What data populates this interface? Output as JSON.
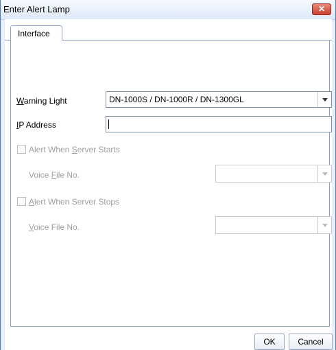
{
  "window": {
    "title": "Enter Alert Lamp",
    "close_icon": "✕"
  },
  "tabs": [
    {
      "label": "Interface",
      "selected": true
    }
  ],
  "form": {
    "warning_light": {
      "label_mnemonic": "W",
      "label_rest": "arning Light",
      "value": "DN-1000S / DN-1000R / DN-1300GL"
    },
    "ip_address": {
      "label_mnemonic": "I",
      "label_rest": "P Address",
      "value": ""
    },
    "alert_start": {
      "label_pre": "Alert When ",
      "label_mnemonic": "S",
      "label_rest": "erver Starts",
      "checked": false,
      "enabled": false
    },
    "voice_start": {
      "label_pre": "Voice ",
      "label_mnemonic": "F",
      "label_rest": "ile No.",
      "value": "",
      "enabled": false
    },
    "alert_stop": {
      "label_mnemonic": "A",
      "label_rest": "lert When Server Stops",
      "checked": false,
      "enabled": false
    },
    "voice_stop": {
      "label_mnemonic": "V",
      "label_rest": "oice File No.",
      "value": "",
      "enabled": false
    }
  },
  "buttons": {
    "ok": "OK",
    "cancel": "Cancel"
  }
}
